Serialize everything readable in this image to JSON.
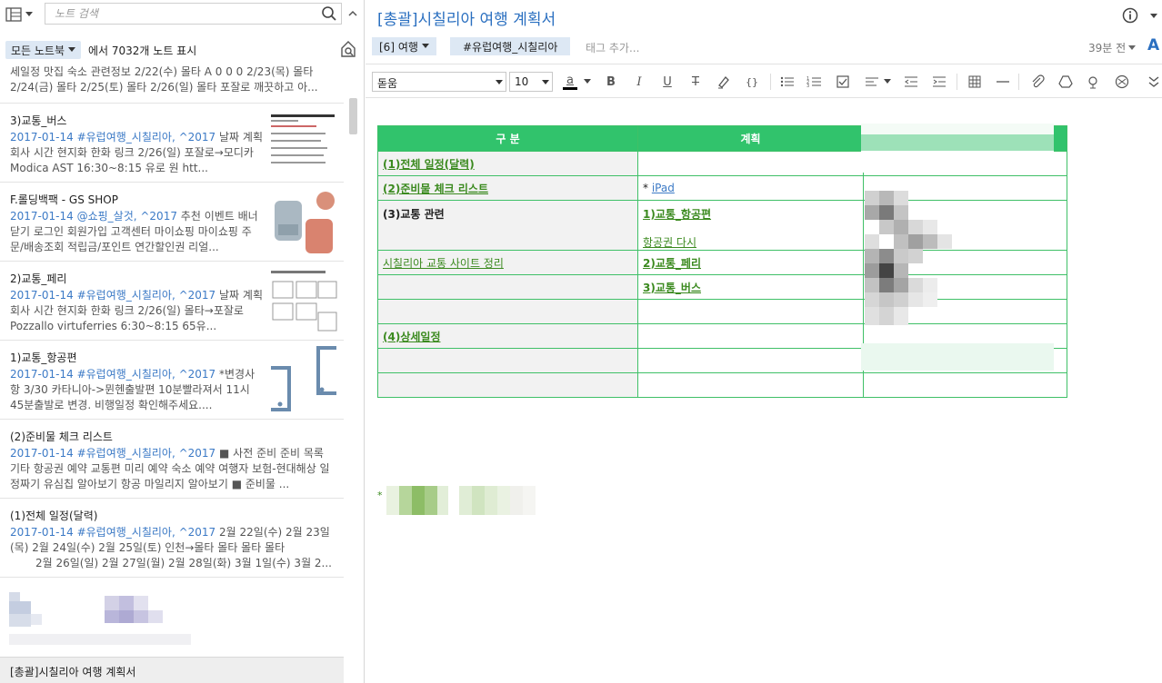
{
  "search": {
    "placeholder": "노트 검색"
  },
  "notebook_filter": {
    "label": "모든 노트북",
    "count_text": "에서 7032개 노트 표시"
  },
  "notes": [
    {
      "title": "",
      "date": "",
      "snippet": "세일정 맛집 숙소 관련정보 2/22(수) 몰타 A 0 0 0 2/23(목) 몰타 2/24(금) 몰타 2/25(토) 몰타 2/26(일) 몰타 포잘로 깨끗하고 아..."
    },
    {
      "title": "3)교통_버스",
      "date": "2017-01-14",
      "tags": "#유럽여행_시칠리아, ^2017",
      "snippet": "날짜 계획 회사 시간 현지화 한화 링크 2/26(일) 포잘로→모디카Modica AST 16:30~8:15 유로 원 htt..."
    },
    {
      "title": "F.롤딩백팩 - GS SHOP",
      "date": "2017-01-14",
      "tags": "@쇼핑_살것, ^2017",
      "snippet": "추천 이벤트 배너닫기 로그인 회원가입 고객센터 마이쇼핑 마이쇼핑 주문/배송조회 적립금/포인트 연간할인권 리얼..."
    },
    {
      "title": "2)교통_페리",
      "date": "2017-01-14",
      "tags": "#유럽여행_시칠리아, ^2017",
      "snippet": "날짜 계획 회사 시간 현지화 한화 링크 2/26(일) 몰타→포잘로 Pozzallo virtuferries 6:30~8:15 65유..."
    },
    {
      "title": "1)교통_항공편",
      "date": "2017-01-14",
      "tags": "#유럽여행_시칠리아, ^2017",
      "snippet": "*변경사항 3/30 카타니아->뮌헨출발편 10분빨라져서 11시45분출발로 변경. 비행일정 확인해주세요...."
    },
    {
      "title": "(2)준비물 체크 리스트",
      "date": "2017-01-14",
      "tags": "#유럽여행_시칠리아, ^2017",
      "snippet": "■ 사전 준비 준비 목록 기타 항공권 예약 교통편 미리 예약 숙소 예약 여행자 보험-현대해상 일정짜기 유심칩 알아보기 항공 마일리지 알아보기 ■ 준비물 ..."
    },
    {
      "title": "(1)전체 일정(달력)",
      "date": "2017-01-14",
      "tags": "#유럽여행_시칠리아, ^2017",
      "snippet": "2월 22일(수) 2월 23일(목) 2월 24일(수) 2월 25일(토) 인천→몰타 몰타 몰타 몰타",
      "snippet2": "2월 26일(일) 2월 27일(월) 2월 28일(화) 3월 1일(수) 3월 2..."
    }
  ],
  "status_bar": {
    "selected_title": "[총괄]시칠리아 여행 계획서"
  },
  "editor": {
    "title": "[총괄]시칠리아 여행 계획서",
    "notebook_chip": "[6] 여행",
    "tag": "#유럽여행_시칠리아",
    "tag_add": "태그 추가...",
    "updated": "39분 전",
    "font_color_letter": "A"
  },
  "toolbar": {
    "font_family": "돋움",
    "font_size": "10",
    "font_color_letter": "a",
    "bold": "B",
    "italic": "I",
    "underline": "U",
    "strike": "T",
    "code": "{}"
  },
  "table": {
    "headers": [
      "구 분",
      "계획",
      ""
    ],
    "rows": [
      {
        "c1": "(1)전체 일정(달력)",
        "c1_style": "lnkb",
        "c2": ""
      },
      {
        "c1": "(2)준비물 체크 리스트",
        "c1_style": "lnkb",
        "c2_prefix": "* ",
        "c2": "iPad",
        "c2_style": "lnkblue"
      },
      {
        "c1": "(3)교통 관련",
        "c1_style": "bold",
        "c2": "1)교통_항공편",
        "c2_style": "lnkb",
        "c2_second": "항공권 다시"
      },
      {
        "c1": "시칠리아 교통 사이트 정리",
        "c1_style": "lnk",
        "c2": "2)교통_페리",
        "c2_style": "lnkb"
      },
      {
        "c1": "",
        "c2": "3)교통_버스",
        "c2_style": "lnkb"
      },
      {
        "c1": "",
        "c2": ""
      },
      {
        "c1": "(4)상세일정",
        "c1_style": "lnkb",
        "c2": ""
      },
      {
        "c1": "",
        "c2": ""
      },
      {
        "c1": "",
        "c2": ""
      }
    ]
  },
  "colors": {
    "accent": "#2a6fc0",
    "table_header": "#31c36c",
    "table_border": "#3fc067",
    "link_green": "#3b8a1f",
    "date_blue": "#3c7ac6"
  }
}
